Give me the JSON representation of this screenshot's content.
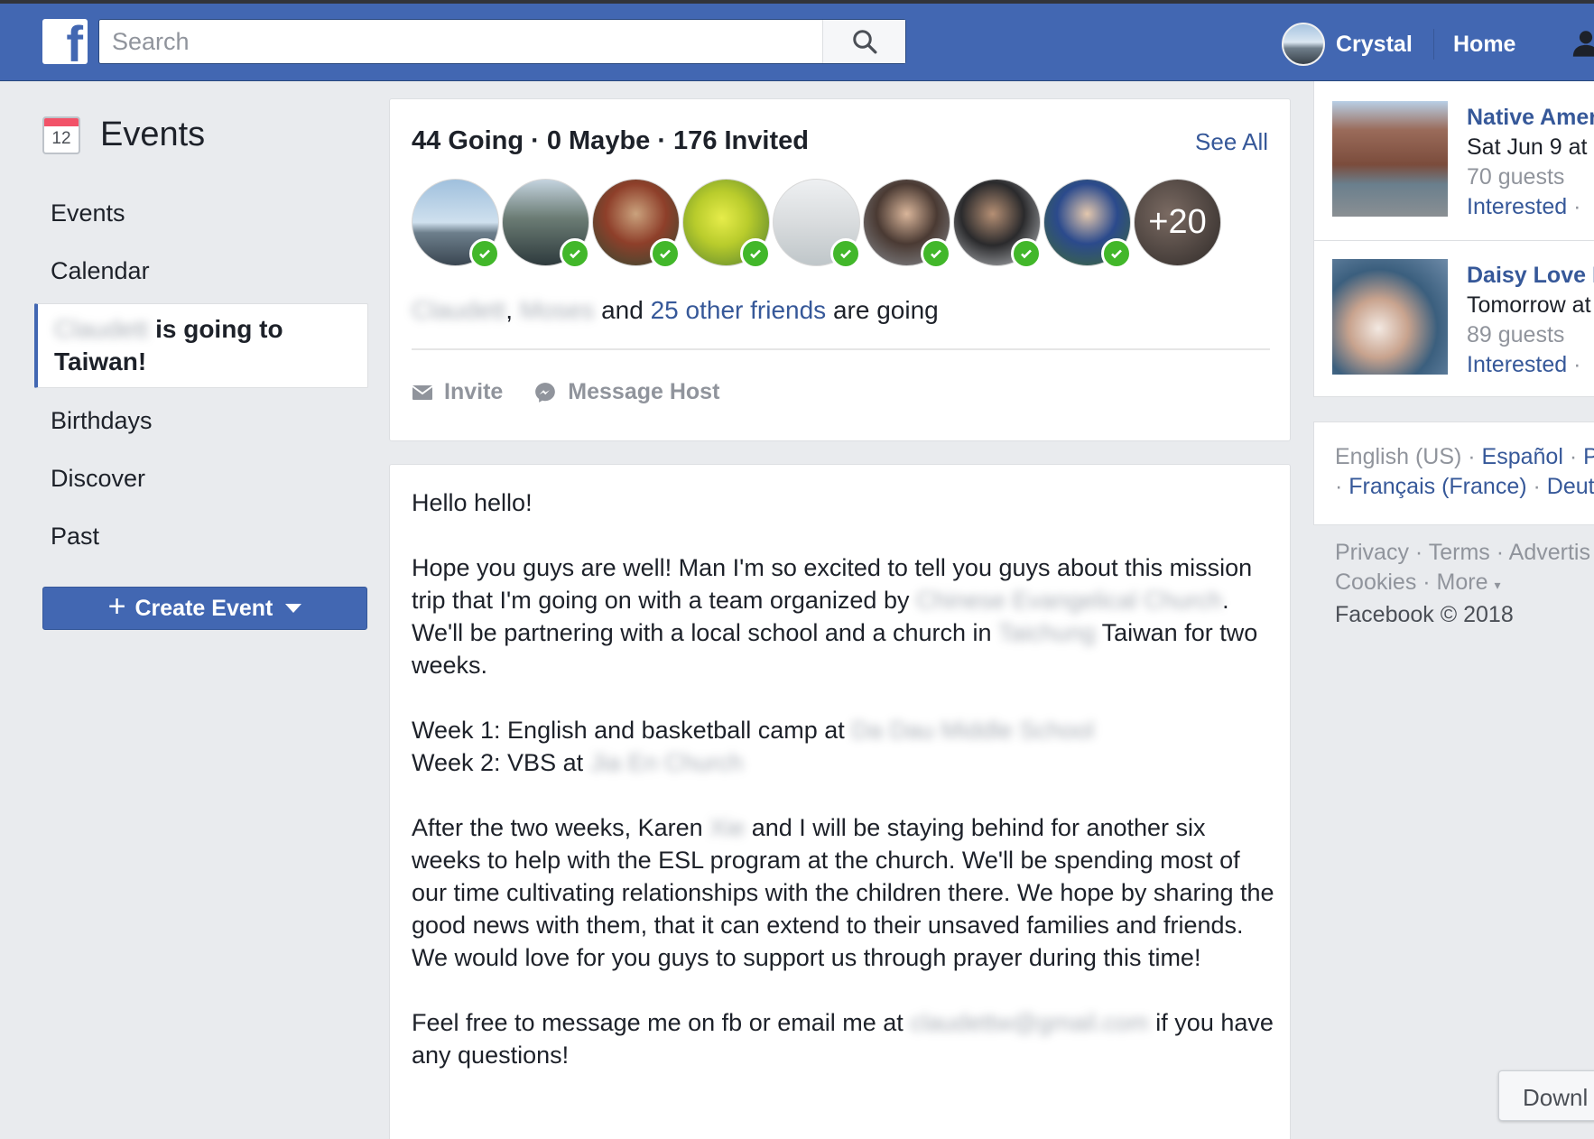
{
  "header": {
    "search_placeholder": "Search",
    "user_name": "Crystal",
    "home_label": "Home"
  },
  "sidebar": {
    "calendar_day": "12",
    "title": "Events",
    "items": [
      {
        "label": "Events"
      },
      {
        "label": "Calendar"
      },
      {
        "label": "Birthdays"
      },
      {
        "label": "Discover"
      },
      {
        "label": "Past"
      }
    ],
    "active_item": {
      "name": "Claudett",
      "text": "is going to Taiwan!"
    },
    "create_event_label": "Create Event"
  },
  "guests": {
    "summary": "44 Going · 0 Maybe · 176 Invited",
    "see_all": "See All",
    "more_count": "+20",
    "friend1": "Claudett",
    "comma": ",",
    "friend2": "Moses",
    "and_text": "and",
    "other_friends": "25 other friends",
    "are_going": "are going",
    "invite_label": "Invite",
    "message_host_label": "Message Host"
  },
  "description": {
    "greeting": "Hello hello!",
    "p1_a": "Hope you guys are well! Man I'm so excited to tell you guys about this mission trip that I'm going on with a team organized by",
    "p1_org": "Chinese Evangelical Church",
    "p1_b": ". We'll be partnering with a local school and a church in",
    "p1_city": "Taichung",
    "p1_c": "Taiwan for two weeks.",
    "week1": "Week 1: English and basketball camp at",
    "week1_place": "Da Dau Middle School",
    "week2": "Week 2: VBS at",
    "week2_place": "Jia En Church",
    "p3_a": "After the two weeks, Karen",
    "p3_name": "Xie",
    "p3_b": "and I will be staying behind for another six weeks to help with the ESL program at the church. We'll be spending most of our time cultivating relationships with the children there. We hope by sharing the good news with them, that it can extend to their unsaved families and friends. We would love for you guys to support us through prayer during this time!",
    "p4_a": "Feel free to message me on fb or email me at",
    "p4_email": "claudettw@gmail.com",
    "p4_b": "if you have any questions!"
  },
  "suggested_events": [
    {
      "title": "Native Amer",
      "date": "Sat Jun 9 at",
      "guests": "70 guests",
      "interested": "Interested",
      "dot": "·"
    },
    {
      "title": "Daisy Love N",
      "date": "Tomorrow at",
      "guests": "89 guests",
      "interested": "Interested",
      "dot": "·"
    }
  ],
  "languages": {
    "current": "English (US)",
    "espanol": "Español",
    "p": "P",
    "francais": "Français (France)",
    "deut": "Deut"
  },
  "footer": {
    "privacy": "Privacy",
    "terms": "Terms",
    "advertis": "Advertis",
    "cookies": "Cookies",
    "more": "More",
    "copyright": "Facebook © 2018"
  },
  "download_tab": "Downl",
  "colors": {
    "brand_blue": "#4267b2",
    "link_blue": "#365899",
    "going_green": "#42b72a",
    "background": "#e9ebee"
  }
}
